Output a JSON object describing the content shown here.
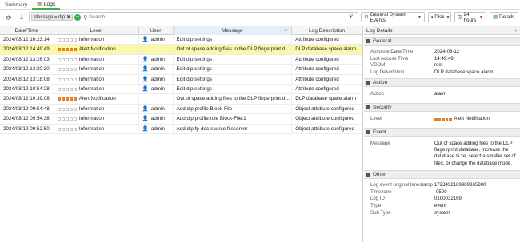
{
  "tabs": [
    {
      "label": "Summary",
      "active": false
    },
    {
      "label": "Logs",
      "active": true
    }
  ],
  "toolbar": {
    "filter_chip": "Message = dlp",
    "search_placeholder": "Search",
    "dropdown_events": "General System Events",
    "dropdown_disk": "Disk",
    "dropdown_time": "24 hours",
    "details_label": "Details"
  },
  "columns": [
    "Date/Time",
    "Level",
    "User",
    "Message",
    "Log Description"
  ],
  "rows": [
    {
      "datetime": "2024/08/12 16:23:14",
      "level": "Information",
      "alert": false,
      "user": "admin",
      "message": "Edit dlp.settings",
      "desc": "Attribute configured",
      "highlight": false
    },
    {
      "datetime": "2024/08/12 14:49:49",
      "level": "Alert Notification",
      "alert": true,
      "user": "",
      "message": "Out of space adding files to the DLP fingerprint databa...",
      "desc": "DLP database space alarm",
      "highlight": true
    },
    {
      "datetime": "2024/08/12 13:26:03",
      "level": "Information",
      "alert": false,
      "user": "admin",
      "message": "Edit dlp.settings",
      "desc": "Attribute configured",
      "highlight": false
    },
    {
      "datetime": "2024/08/12 13:20:30",
      "level": "Information",
      "alert": false,
      "user": "admin",
      "message": "Edit dlp.settings",
      "desc": "Attribute configured",
      "highlight": false
    },
    {
      "datetime": "2024/08/12 13:18:08",
      "level": "Information",
      "alert": false,
      "user": "admin",
      "message": "Edit dlp.settings",
      "desc": "Attribute configured",
      "highlight": false
    },
    {
      "datetime": "2024/08/12 10:54:28",
      "level": "Information",
      "alert": false,
      "user": "admin",
      "message": "Edit dlp.settings",
      "desc": "Attribute configured",
      "highlight": false
    },
    {
      "datetime": "2024/08/12 10:39:08",
      "level": "Alert Notification",
      "alert": true,
      "user": "",
      "message": "Out of space adding files to the DLP fingerprint databa...",
      "desc": "DLP database space alarm",
      "highlight": false
    },
    {
      "datetime": "2024/08/12 09:54:48",
      "level": "Information",
      "alert": false,
      "user": "admin",
      "message": "Add dlp.profile Block-File",
      "desc": "Object attribute configured",
      "highlight": false
    },
    {
      "datetime": "2024/08/12 09:54:38",
      "level": "Information",
      "alert": false,
      "user": "admin",
      "message": "Add dlp.profile:rule Block-File:1",
      "desc": "Object attribute configured",
      "highlight": false
    },
    {
      "datetime": "2024/08/12 09:52:50",
      "level": "Information",
      "alert": false,
      "user": "admin",
      "message": "Add dlp.fp-doc-source fileserver",
      "desc": "Object attribute configured",
      "highlight": false
    }
  ],
  "details": {
    "title": "Log Details",
    "general_title": "General",
    "general": [
      {
        "k": "Absolute Date/Time",
        "v": "2024-08-12"
      },
      {
        "k": "Last Access Time",
        "v": "14:49:49"
      },
      {
        "k": "VDOM",
        "v": "root"
      },
      {
        "k": "Log Description",
        "v": "DLP database space alarm"
      }
    ],
    "action_title": "Action",
    "action": [
      {
        "k": "Action",
        "v": "alarm"
      }
    ],
    "security_title": "Security",
    "security_level_label": "Level",
    "security_level_value": "Alert Notification",
    "event_title": "Event",
    "event_msg_label": "Message",
    "event_msg_value": "Out of space adding files to the DLP finge rprint database. Increase the database si ze, select a smaller set of files, or change the database mode.",
    "other_title": "Other",
    "other": [
      {
        "k": "Log event original timestamp",
        "v": "1723492189989365800"
      },
      {
        "k": "Timezone",
        "v": "-0500"
      },
      {
        "k": "Log ID",
        "v": "0100032169"
      },
      {
        "k": "Type",
        "v": "event"
      },
      {
        "k": "Sub Type",
        "v": "system"
      }
    ]
  },
  "colors": {
    "accent": "#3fae49",
    "alert": "#f08a24",
    "highlight": "#fbf7a8"
  }
}
